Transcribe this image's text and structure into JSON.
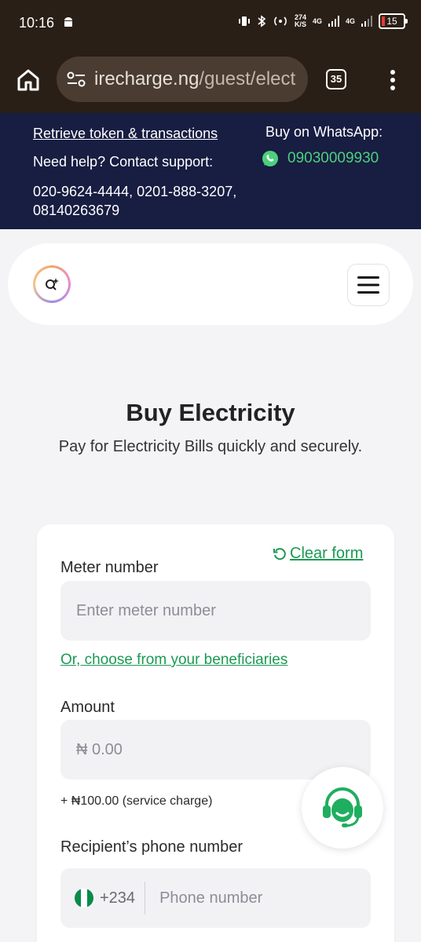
{
  "status_bar": {
    "time": "10:16",
    "net_speed_top": "274",
    "net_speed_bottom": "K/S",
    "network_1": "4G",
    "network_2": "4G",
    "battery": "15"
  },
  "browser": {
    "url_domain": "irecharge.ng",
    "url_path": "/guest/elect",
    "tab_count": "35"
  },
  "banner": {
    "retrieve_link": "Retrieve token & transactions",
    "help_text": "Need help? Contact support:",
    "phones": "020-9624-4444, 0201-888-3207, 08140263679",
    "whatsapp_label": "Buy on WhatsApp:",
    "whatsapp_number": "09030009930"
  },
  "page": {
    "title": "Buy Electricity",
    "subtitle": "Pay for Electricity Bills quickly and securely."
  },
  "form": {
    "clear_label": "Clear form",
    "meter_label": "Meter number",
    "meter_placeholder": "Enter meter number",
    "beneficiary_link": "Or, choose from your beneficiaries",
    "amount_label": "Amount",
    "amount_placeholder": "₦ 0.00",
    "service_charge": "+ ₦100.00 (service charge)",
    "phone_label": "Recipient’s phone number",
    "country_code": "+234",
    "phone_placeholder": "Phone number"
  },
  "colors": {
    "banner_bg": "#181d42",
    "accent_green": "#1b9a54",
    "whatsapp_green": "#4cd07d"
  },
  "icons": {
    "home": "home-icon",
    "site_settings": "tune-icon",
    "more": "more-vert-icon",
    "whatsapp": "whatsapp-icon",
    "menu": "hamburger-menu-icon",
    "clear": "refresh-icon",
    "support": "headset-support-icon"
  }
}
